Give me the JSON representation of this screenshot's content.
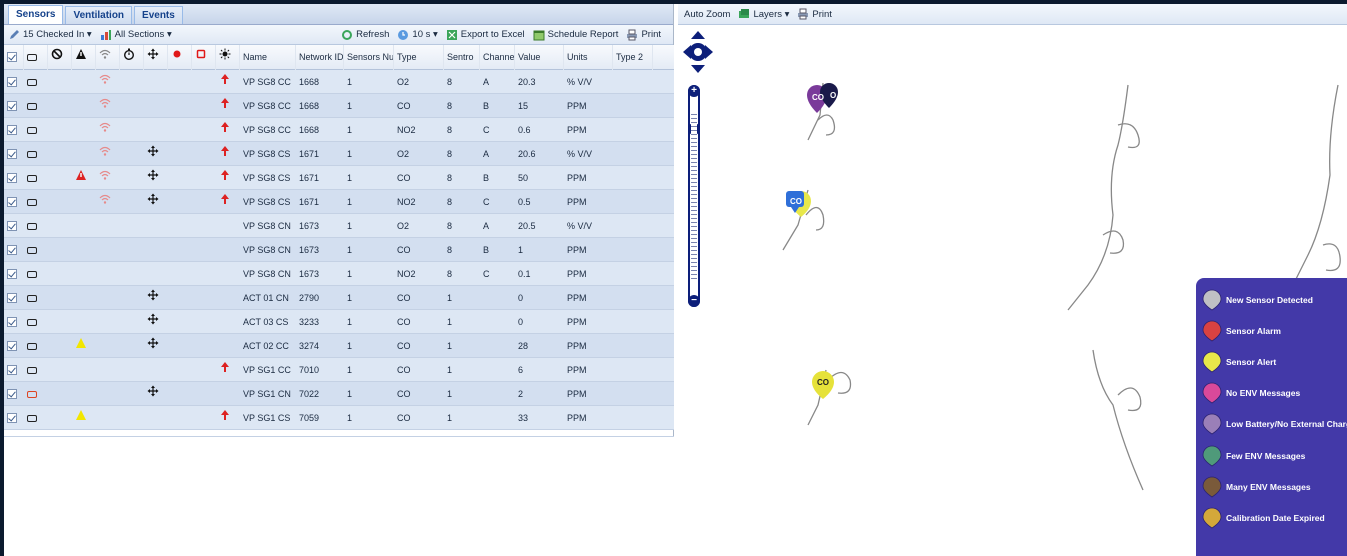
{
  "tabs": [
    {
      "label": "Sensors"
    },
    {
      "label": "Ventilation"
    },
    {
      "label": "Events"
    }
  ],
  "toolbar": {
    "checked_in": "15 Checked In ▾",
    "sections": "All Sections ▾",
    "refresh": "Refresh",
    "interval": "10 s ▾",
    "export": "Export to Excel",
    "schedule": "Schedule Report",
    "print": "Print"
  },
  "grid": {
    "headers": {
      "name": "Name",
      "network_id": "Network ID ▴",
      "sensors_num": "Sensors Num",
      "type": "Type",
      "sentro": "Sentro",
      "channel": "Channel",
      "value": "Value",
      "units": "Units",
      "type2": "Type 2"
    },
    "rows": [
      {
        "bat": "ok",
        "warn": "",
        "wifi": true,
        "move": false,
        "up": true,
        "name": "VP SG8 CC",
        "net": "1668",
        "num": "1",
        "type": "O2",
        "sentro": "8",
        "channel": "A",
        "value": "20.3",
        "units": "% V/V"
      },
      {
        "bat": "ok",
        "warn": "",
        "wifi": true,
        "move": false,
        "up": true,
        "name": "VP SG8 CC",
        "net": "1668",
        "num": "1",
        "type": "CO",
        "sentro": "8",
        "channel": "B",
        "value": "15",
        "units": "PPM"
      },
      {
        "bat": "ok",
        "warn": "",
        "wifi": true,
        "move": false,
        "up": true,
        "name": "VP SG8 CC",
        "net": "1668",
        "num": "1",
        "type": "NO2",
        "sentro": "8",
        "channel": "C",
        "value": "0.6",
        "units": "PPM"
      },
      {
        "bat": "ok",
        "warn": "",
        "wifi": true,
        "move": true,
        "up": true,
        "name": "VP SG8 CS",
        "net": "1671",
        "num": "1",
        "type": "O2",
        "sentro": "8",
        "channel": "A",
        "value": "20.6",
        "units": "% V/V"
      },
      {
        "bat": "ok",
        "warn": "red",
        "wifi": true,
        "move": true,
        "up": true,
        "name": "VP SG8 CS",
        "net": "1671",
        "num": "1",
        "type": "CO",
        "sentro": "8",
        "channel": "B",
        "value": "50",
        "units": "PPM"
      },
      {
        "bat": "ok",
        "warn": "",
        "wifi": true,
        "move": true,
        "up": true,
        "name": "VP SG8 CS",
        "net": "1671",
        "num": "1",
        "type": "NO2",
        "sentro": "8",
        "channel": "C",
        "value": "0.5",
        "units": "PPM"
      },
      {
        "bat": "ok",
        "warn": "",
        "wifi": false,
        "move": false,
        "up": false,
        "name": "VP SG8 CN",
        "net": "1673",
        "num": "1",
        "type": "O2",
        "sentro": "8",
        "channel": "A",
        "value": "20.5",
        "units": "% V/V"
      },
      {
        "bat": "ok",
        "warn": "",
        "wifi": false,
        "move": false,
        "up": false,
        "name": "VP SG8 CN",
        "net": "1673",
        "num": "1",
        "type": "CO",
        "sentro": "8",
        "channel": "B",
        "value": "1",
        "units": "PPM"
      },
      {
        "bat": "ok",
        "warn": "",
        "wifi": false,
        "move": false,
        "up": false,
        "name": "VP SG8 CN",
        "net": "1673",
        "num": "1",
        "type": "NO2",
        "sentro": "8",
        "channel": "C",
        "value": "0.1",
        "units": "PPM"
      },
      {
        "bat": "ok",
        "warn": "",
        "wifi": false,
        "move": true,
        "up": false,
        "name": "ACT 01 CN",
        "net": "2790",
        "num": "1",
        "type": "CO",
        "sentro": "1",
        "channel": "",
        "value": "0",
        "units": "PPM"
      },
      {
        "bat": "ok",
        "warn": "",
        "wifi": false,
        "move": true,
        "up": false,
        "name": "ACT 03 CS",
        "net": "3233",
        "num": "1",
        "type": "CO",
        "sentro": "1",
        "channel": "",
        "value": "0",
        "units": "PPM"
      },
      {
        "bat": "ok",
        "warn": "yellow",
        "wifi": false,
        "move": true,
        "up": false,
        "name": "ACT 02 CC",
        "net": "3274",
        "num": "1",
        "type": "CO",
        "sentro": "1",
        "channel": "",
        "value": "28",
        "units": "PPM"
      },
      {
        "bat": "ok",
        "warn": "",
        "wifi": false,
        "move": false,
        "up": true,
        "name": "VP SG1 CC",
        "net": "7010",
        "num": "1",
        "type": "CO",
        "sentro": "1",
        "channel": "",
        "value": "6",
        "units": "PPM"
      },
      {
        "bat": "red",
        "warn": "",
        "wifi": false,
        "move": true,
        "up": false,
        "name": "VP SG1 CN",
        "net": "7022",
        "num": "1",
        "type": "CO",
        "sentro": "1",
        "channel": "",
        "value": "2",
        "units": "PPM"
      },
      {
        "bat": "ok",
        "warn": "yellow",
        "wifi": false,
        "move": false,
        "up": true,
        "name": "VP SG1 CS",
        "net": "7059",
        "num": "1",
        "type": "CO",
        "sentro": "1",
        "channel": "",
        "value": "33",
        "units": "PPM"
      }
    ]
  },
  "map_toolbar": {
    "auto_zoom": "Auto Zoom",
    "layers": "Layers ▾",
    "print": "Print"
  },
  "map": {
    "marker_labels": [
      "CO",
      "O",
      "CO",
      "CO"
    ],
    "zoom_in": "+",
    "zoom_out": "−"
  },
  "legend": [
    {
      "label": "New Sensor Detected",
      "color": "#bfc0c4"
    },
    {
      "label": "Sensor Alarm",
      "color": "#d94242"
    },
    {
      "label": "Sensor Alert",
      "color": "#e8e84a"
    },
    {
      "label": "No ENV Messages",
      "color": "#d9499a"
    },
    {
      "label": "Low Battery/No External Charge",
      "color": "#9a7fb8"
    },
    {
      "label": "Few ENV Messages",
      "color": "#4f9a7a"
    },
    {
      "label": "Many ENV Messages",
      "color": "#7a5a3a"
    },
    {
      "label": "Calibration Date Expired",
      "color": "#d4a83a"
    }
  ]
}
